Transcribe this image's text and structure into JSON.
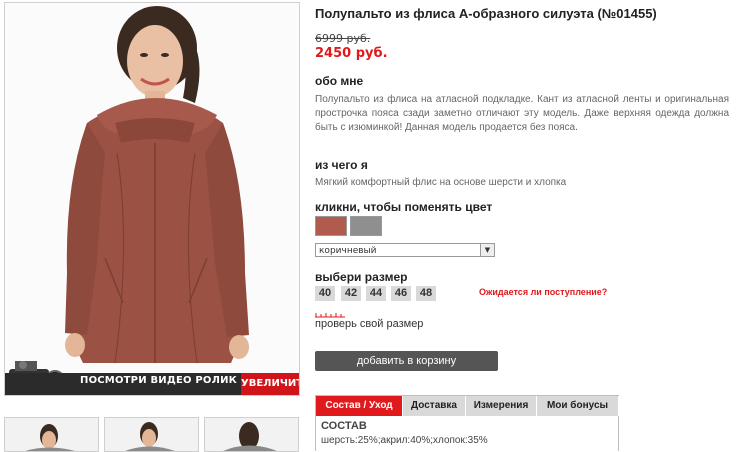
{
  "product": {
    "title": "Полупальто из флиса А-образного силуэта (№01455)",
    "old_price": "6999 руб.",
    "new_price": "2450 руб."
  },
  "about": {
    "heading": "обо мне",
    "text": "Полупальто из флиса на атласной подкладке. Кант из атласной ленты и оригинальная прострочка пояса сзади заметно отличают эту модель. Даже верхняя одежда должна быть с изюминкой! Данная модель продается без пояса."
  },
  "material": {
    "heading": "из чего я",
    "text": "Мягкий комфортный флис на основе шерсти и хлопка"
  },
  "color": {
    "heading": "кликни, чтобы поменять цвет",
    "swatches": [
      "#b05b4d",
      "#8f8f8f"
    ],
    "selected": "коричневый"
  },
  "size": {
    "heading": "выбери размер",
    "options": [
      "40",
      "42",
      "44",
      "46",
      "48"
    ],
    "notify_link": "Ожидается ли поступление?",
    "check_link": "проверь свой размер"
  },
  "cart": {
    "button": "добавить в корзину"
  },
  "image": {
    "video_label": "ПОСМОТРИ ВИДЕО РОЛИК",
    "zoom_label": "УВЕЛИЧИТЬ",
    "coat_color": "#9b5144"
  },
  "tabs": {
    "items": [
      "Состав / Уход",
      "Доставка",
      "Измерения",
      "Мои бонусы"
    ],
    "active_heading": "СОСТАВ",
    "active_text": "шерсть:25%;акрил:40%;хлопок:35%"
  },
  "colors": {
    "accent": "#e0191c",
    "button": "#555555"
  }
}
